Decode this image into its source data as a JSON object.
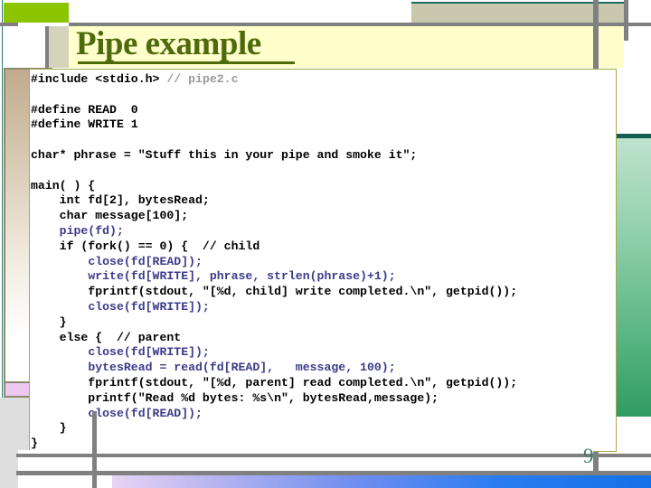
{
  "slide": {
    "title": "Pipe example",
    "page_number": "9",
    "title_color": "#4E6B0C",
    "accent_green": "#8CC400",
    "accent_blue": "#3B3B8C",
    "comment_gray": "#9A9A9A",
    "panel_bg": "#FFFFFF",
    "title_band_bg": "#FFFFCC"
  },
  "code": {
    "language": "c",
    "lines": [
      [
        {
          "t": "#include <stdio.h> ",
          "c": "black"
        },
        {
          "t": "// pipe2.c",
          "c": "gray"
        }
      ],
      [],
      [
        {
          "t": "#define READ  0",
          "c": "black"
        }
      ],
      [
        {
          "t": "#define WRITE 1",
          "c": "black"
        }
      ],
      [],
      [
        {
          "t": "char* phrase = \"Stuff this in your pipe and smoke it\";",
          "c": "black"
        }
      ],
      [],
      [
        {
          "t": "main( ) {",
          "c": "black"
        }
      ],
      [
        {
          "t": "    int fd[2], bytesRead;",
          "c": "black"
        }
      ],
      [
        {
          "t": "    char message[100];",
          "c": "black"
        }
      ],
      [
        {
          "t": "    ",
          "c": "black"
        },
        {
          "t": "pipe(fd);",
          "c": "blue"
        }
      ],
      [
        {
          "t": "    if (fork() == 0) {  // child",
          "c": "black"
        }
      ],
      [
        {
          "t": "        ",
          "c": "black"
        },
        {
          "t": "close(fd[READ]);",
          "c": "blue"
        }
      ],
      [
        {
          "t": "        ",
          "c": "black"
        },
        {
          "t": "write(fd[WRITE], phrase, strlen(phrase)+1);",
          "c": "blue"
        }
      ],
      [
        {
          "t": "        fprintf(stdout, \"[%d, child] write completed.\\n\", getpid());",
          "c": "black"
        }
      ],
      [
        {
          "t": "        ",
          "c": "black"
        },
        {
          "t": "close(fd[WRITE]);",
          "c": "blue"
        }
      ],
      [
        {
          "t": "    }",
          "c": "black"
        }
      ],
      [
        {
          "t": "    else {  // parent",
          "c": "black"
        }
      ],
      [
        {
          "t": "        ",
          "c": "black"
        },
        {
          "t": "close(fd[WRITE]);",
          "c": "blue"
        }
      ],
      [
        {
          "t": "        ",
          "c": "black"
        },
        {
          "t": "bytesRead = read(fd[READ],   message, 100);",
          "c": "blue"
        }
      ],
      [
        {
          "t": "        fprintf(stdout, \"[%d, parent] read completed.\\n\", getpid());",
          "c": "black"
        }
      ],
      [
        {
          "t": "        printf(\"Read %d bytes: %s\\n\", bytesRead,message);",
          "c": "black"
        }
      ],
      [
        {
          "t": "        ",
          "c": "black"
        },
        {
          "t": "close(fd[READ]);",
          "c": "blue"
        }
      ],
      [
        {
          "t": "    }",
          "c": "black"
        }
      ],
      [
        {
          "t": "}",
          "c": "black"
        }
      ]
    ]
  }
}
